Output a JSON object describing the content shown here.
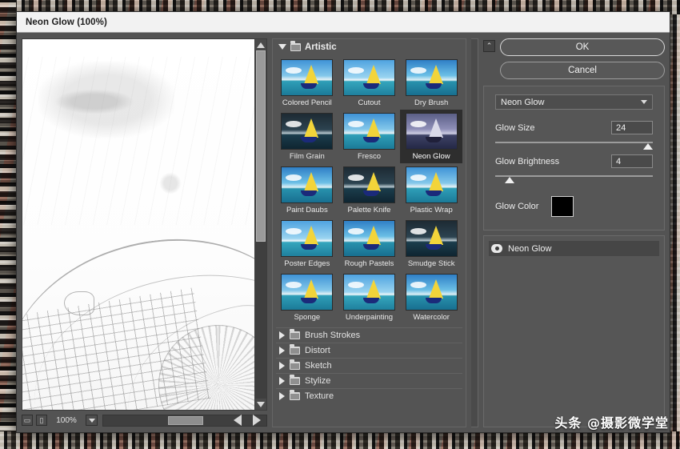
{
  "window": {
    "title": "Neon Glow (100%)"
  },
  "preview": {
    "zoom_value": "100%",
    "zoom_out_icon": "zoom-out-icon",
    "zoom_in_icon": "zoom-in-icon",
    "caret_icon": "chevron-down-icon",
    "scroll_up_icon": "triangle-up-icon",
    "scroll_down_icon": "triangle-down-icon",
    "scroll_left_icon": "triangle-left-icon",
    "scroll_right_icon": "triangle-right-icon"
  },
  "gallery": {
    "expanded_category": {
      "label": "Artistic",
      "disclosure_icon": "triangle-down-icon",
      "folder_icon": "folder-icon"
    },
    "filters": [
      {
        "label": "Colored Pencil",
        "selected": false
      },
      {
        "label": "Cutout",
        "selected": false
      },
      {
        "label": "Dry Brush",
        "selected": false
      },
      {
        "label": "Film Grain",
        "selected": false
      },
      {
        "label": "Fresco",
        "selected": false
      },
      {
        "label": "Neon Glow",
        "selected": true
      },
      {
        "label": "Paint Daubs",
        "selected": false
      },
      {
        "label": "Palette Knife",
        "selected": false
      },
      {
        "label": "Plastic Wrap",
        "selected": false
      },
      {
        "label": "Poster Edges",
        "selected": false
      },
      {
        "label": "Rough Pastels",
        "selected": false
      },
      {
        "label": "Smudge Stick",
        "selected": false
      },
      {
        "label": "Sponge",
        "selected": false
      },
      {
        "label": "Underpainting",
        "selected": false
      },
      {
        "label": "Watercolor",
        "selected": false
      }
    ],
    "categories": [
      {
        "label": "Brush Strokes",
        "disclosure_icon": "triangle-right-icon"
      },
      {
        "label": "Distort",
        "disclosure_icon": "triangle-right-icon"
      },
      {
        "label": "Sketch",
        "disclosure_icon": "triangle-right-icon"
      },
      {
        "label": "Stylize",
        "disclosure_icon": "triangle-right-icon"
      },
      {
        "label": "Texture",
        "disclosure_icon": "triangle-right-icon"
      }
    ]
  },
  "controls": {
    "collapse_icon": "double-chevron-up-icon",
    "ok_label": "OK",
    "cancel_label": "Cancel",
    "filter_select": {
      "value": "Neon Glow",
      "caret_icon": "chevron-down-icon"
    },
    "params": [
      {
        "label": "Glow Size",
        "value": "24",
        "knob_percent": 97
      },
      {
        "label": "Glow Brightness",
        "value": "4",
        "knob_percent": 9
      }
    ],
    "glow_color": {
      "label": "Glow Color",
      "swatch_hex": "#000000"
    }
  },
  "layers": {
    "items": [
      {
        "name": "Neon Glow",
        "visibility_icon": "eye-icon"
      }
    ]
  },
  "watermark": {
    "text": "头条 @摄影微学堂"
  }
}
